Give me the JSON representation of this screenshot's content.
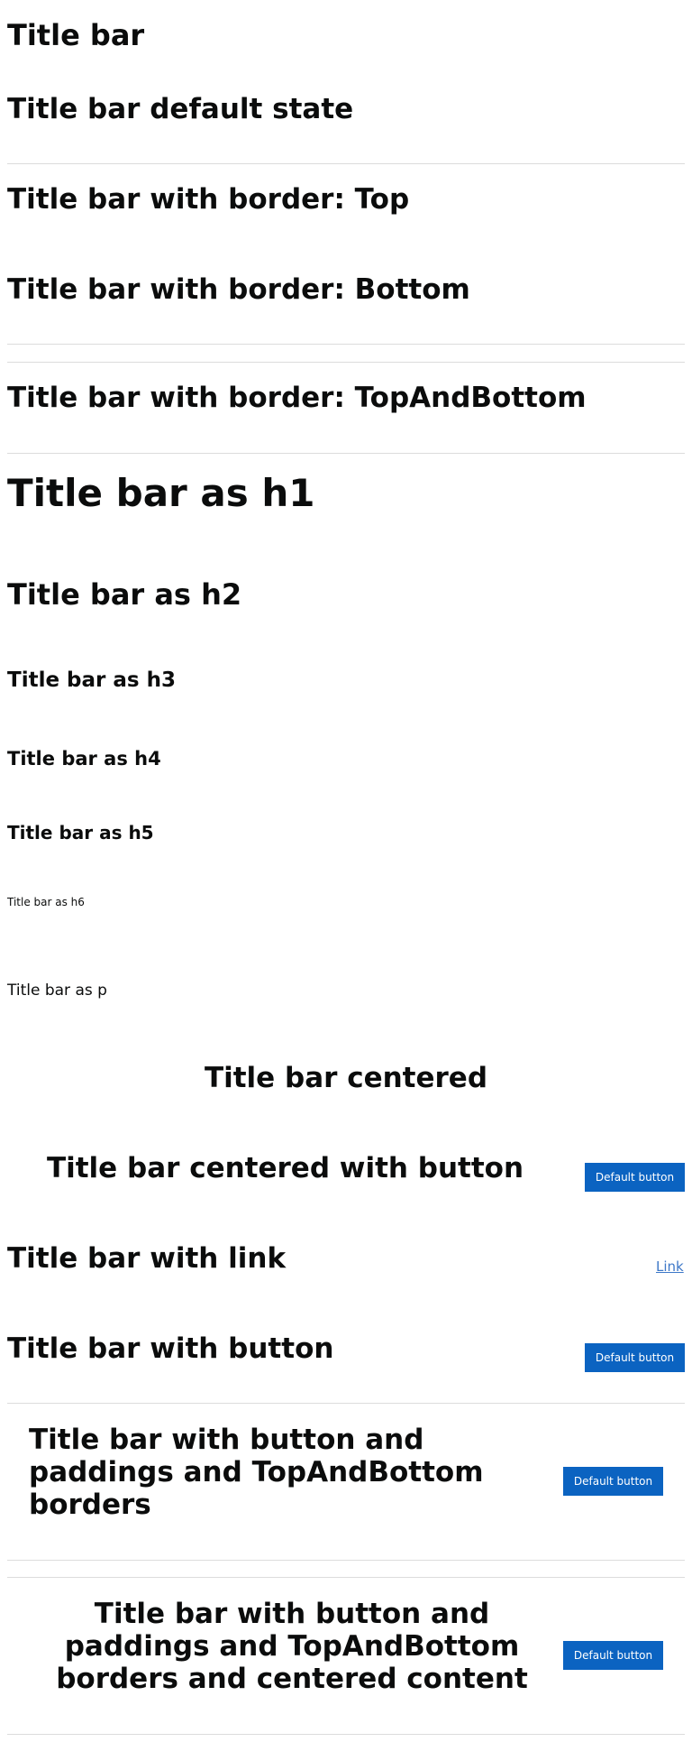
{
  "page_title": "Title bar",
  "sections": {
    "default": "Title bar default state",
    "border_top": "Title bar with border: Top",
    "border_bottom": "Title bar with border: Bottom",
    "border_top_bottom": "Title bar with border: TopAndBottom",
    "h1": "Title bar as h1",
    "h2": "Title bar as h2",
    "h3": "Title bar as h3",
    "h4": "Title bar as h4",
    "h5": "Title bar as h5",
    "h6": "Title bar as h6",
    "p": "Title bar as p",
    "centered": "Title bar centered",
    "centered_with_button": "Title bar centered with button",
    "with_link": "Title bar with link",
    "with_button": "Title bar with button",
    "padded_line1": "Title bar with button and",
    "padded_line2": "paddings and TopAndBottom",
    "padded_line3": "borders",
    "padded_centered_line1": "Title bar with button and",
    "padded_centered_line2": "paddings and TopAndBottom",
    "padded_centered_line3": "borders and centered content"
  },
  "buttons": {
    "default_label": "Default button"
  },
  "link_label": "Link",
  "colors": {
    "button_bg": "#0b63c1",
    "link": "#3e78c8",
    "border": "#dcdcdc",
    "text": "#0b0c0c"
  }
}
